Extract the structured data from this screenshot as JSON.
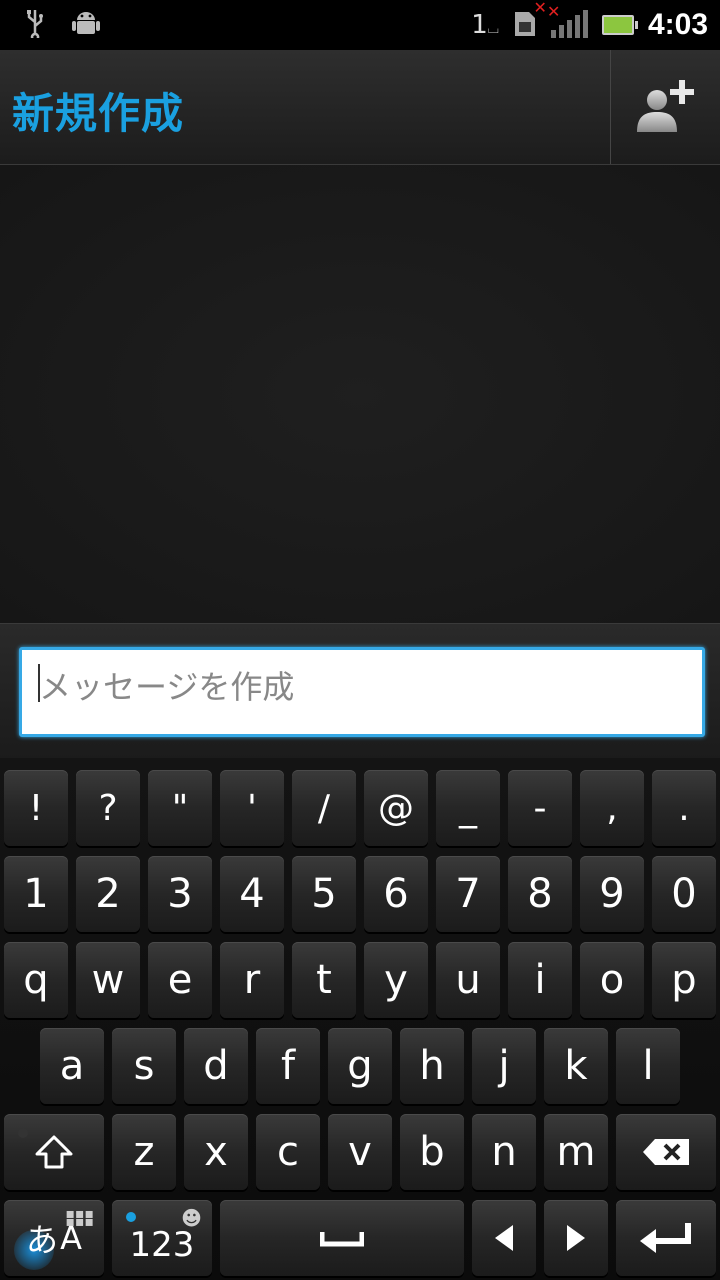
{
  "status_bar": {
    "time": "4:03",
    "sim_slot": "1",
    "icons": [
      "usb-icon",
      "android-debug-icon",
      "sim-card-icon",
      "signal-icon",
      "battery-icon"
    ]
  },
  "header": {
    "title": "新規作成",
    "add_recipient_icon": "add-contact-icon"
  },
  "compose": {
    "placeholder": "メッセージを作成"
  },
  "keyboard": {
    "row_symbols": [
      "!",
      "?",
      "\"",
      "'",
      "/",
      "@",
      "_",
      "-",
      ",",
      "."
    ],
    "row_numbers": [
      "1",
      "2",
      "3",
      "4",
      "5",
      "6",
      "7",
      "8",
      "9",
      "0"
    ],
    "row_q": [
      "q",
      "w",
      "e",
      "r",
      "t",
      "y",
      "u",
      "i",
      "o",
      "p"
    ],
    "row_a": [
      "a",
      "s",
      "d",
      "f",
      "g",
      "h",
      "j",
      "k",
      "l"
    ],
    "row_z": [
      "z",
      "x",
      "c",
      "v",
      "b",
      "n",
      "m"
    ],
    "lang_key_label_jp": "あ",
    "lang_key_label_en": "A",
    "num_key_label": "123"
  },
  "colors": {
    "accent": "#1aa0e0",
    "field_border": "#36a9e6"
  }
}
